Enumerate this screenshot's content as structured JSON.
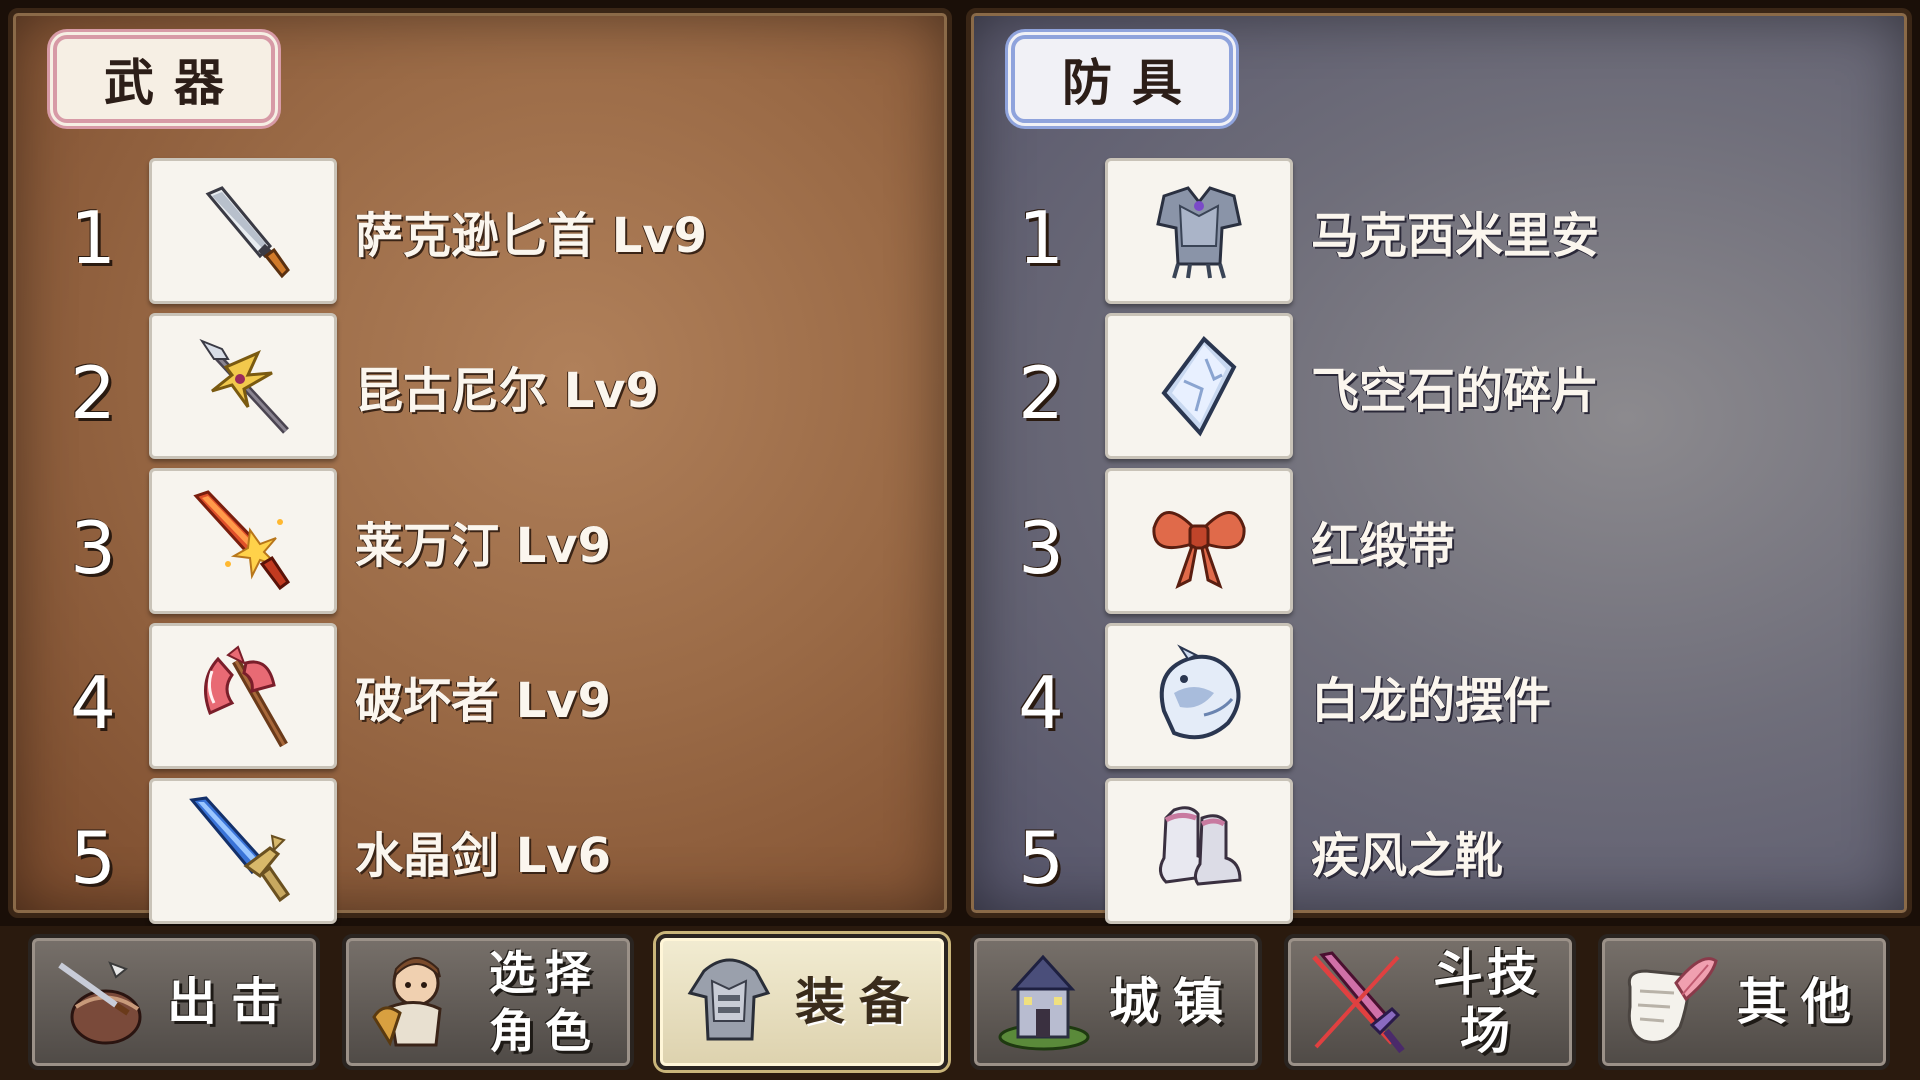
{
  "weapons": {
    "title": "武器",
    "items": [
      {
        "num": "1",
        "name": "萨克逊匕首 Lv9",
        "icon": "dagger-icon"
      },
      {
        "num": "2",
        "name": "昆古尼尔 Lv9",
        "icon": "spear-icon"
      },
      {
        "num": "3",
        "name": "莱万汀 Lv9",
        "icon": "flame-sword-icon"
      },
      {
        "num": "4",
        "name": "破坏者 Lv9",
        "icon": "axe-icon"
      },
      {
        "num": "5",
        "name": "水晶剑 Lv6",
        "icon": "crystal-sword-icon"
      }
    ]
  },
  "armor": {
    "title": "防具",
    "items": [
      {
        "num": "1",
        "name": "马克西米里安",
        "icon": "plate-armor-icon"
      },
      {
        "num": "2",
        "name": "飞空石的碎片",
        "icon": "crystal-shard-icon"
      },
      {
        "num": "3",
        "name": "红缎带",
        "icon": "red-ribbon-icon"
      },
      {
        "num": "4",
        "name": "白龙的摆件",
        "icon": "white-dragon-icon"
      },
      {
        "num": "5",
        "name": "疾风之靴",
        "icon": "boots-icon"
      }
    ]
  },
  "nav": [
    {
      "label": "出击",
      "icon": "sortie-icon",
      "active": false
    },
    {
      "label_line1": "选择",
      "label_line2": "角色",
      "icon": "character-icon",
      "active": false
    },
    {
      "label": "装备",
      "icon": "equipment-icon",
      "active": true
    },
    {
      "label": "城镇",
      "icon": "town-icon",
      "active": false
    },
    {
      "label": "斗技场",
      "icon": "arena-icon",
      "active": false
    },
    {
      "label": "其他",
      "icon": "other-icon",
      "active": false
    }
  ],
  "colors": {
    "weapons_panel": "#9a6a46",
    "armor_panel": "#6f6e7a",
    "weapons_title_border": "#d79aa6",
    "armor_title_border": "#8fa3dc",
    "active_button": "#f2ecd2"
  }
}
